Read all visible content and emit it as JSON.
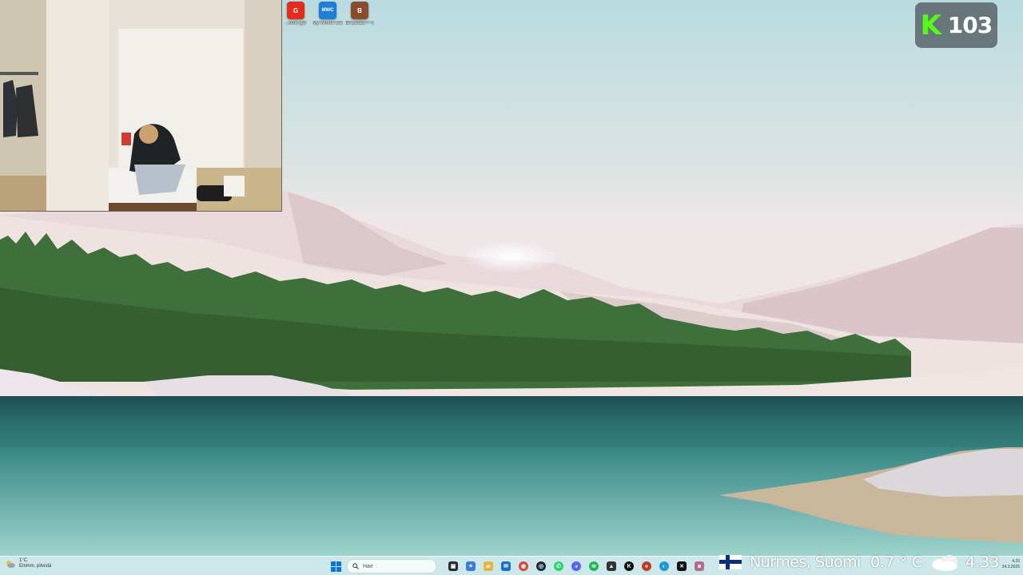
{
  "desktop_icons": [
    {
      "name": "desktop-icon-game-1",
      "label": "...ome\ngar",
      "color": "#e52c1c",
      "glyph": "G"
    },
    {
      "name": "desktop-icon-my-winter-car",
      "label": "My Winter\nCar",
      "color": "#1f7fd6",
      "glyph": "MWC"
    },
    {
      "name": "desktop-icon-game-3",
      "label": "BALDIES™ s",
      "color": "#8a4a2e",
      "glyph": "B"
    }
  ],
  "kick": {
    "viewer_count": "103",
    "logo_letter": "K",
    "brand_color": "#53fc18"
  },
  "taskbar": {
    "weather": {
      "temp": "1°C",
      "desc": "Enimm. pilvistä"
    },
    "search_placeholder": "Hae",
    "apps": [
      {
        "name": "task-view-app",
        "glyph": "▣",
        "color": "#2b2b2b"
      },
      {
        "name": "copilot-app",
        "glyph": "✦",
        "color": "#3b7bd9"
      },
      {
        "name": "file-explorer-app",
        "glyph": "▰",
        "color": "#e8b43a"
      },
      {
        "name": "mail-app",
        "glyph": "✉",
        "color": "#1c6fc9"
      },
      {
        "name": "chrome-app",
        "glyph": "◉",
        "color": "#db4437"
      },
      {
        "name": "steam-app",
        "glyph": "◎",
        "color": "#1b2838"
      },
      {
        "name": "whatsapp-app",
        "glyph": "✆",
        "color": "#25d366"
      },
      {
        "name": "discord-app",
        "glyph": "◕",
        "color": "#5865f2"
      },
      {
        "name": "spotify-app",
        "glyph": "≋",
        "color": "#1db954"
      },
      {
        "name": "photo-app",
        "glyph": "▲",
        "color": "#333333"
      },
      {
        "name": "kick-app",
        "glyph": "K",
        "color": "#111111"
      },
      {
        "name": "record-app",
        "glyph": "●",
        "color": "#c0392b"
      },
      {
        "name": "edge-app",
        "glyph": "◐",
        "color": "#1a9ad6"
      },
      {
        "name": "capcut-app",
        "glyph": "✕",
        "color": "#111111"
      },
      {
        "name": "extra-app",
        "glyph": "☻",
        "color": "#b56a8a"
      }
    ]
  },
  "location_overlay": {
    "location": "Nurmes, Suomi",
    "temperature": "0.7 ° C",
    "time": "4.33"
  },
  "clock": {
    "time": "4.33",
    "date": "24.3.2026"
  }
}
